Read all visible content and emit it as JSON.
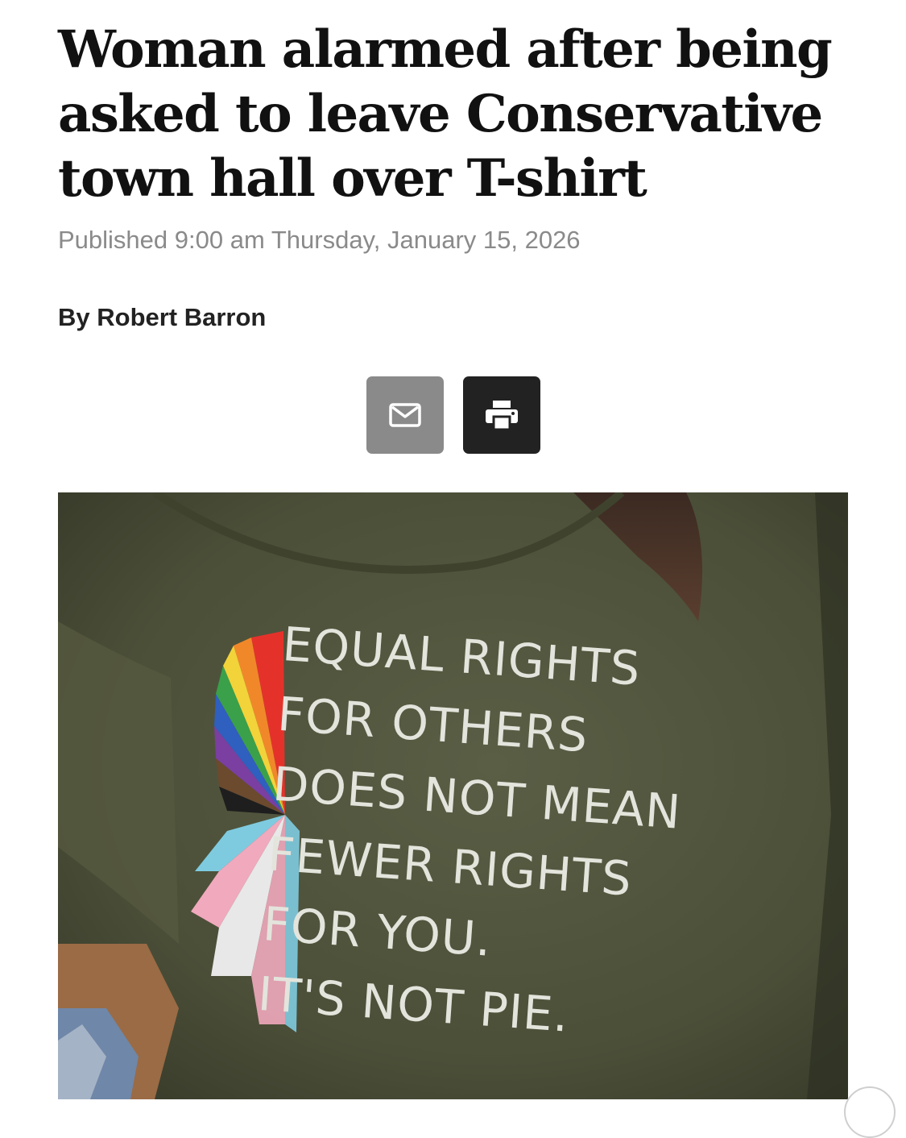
{
  "article": {
    "headline": "Woman alarmed after being asked to leave Conservative town hall over T-shirt",
    "published": "Published 9:00 am Thursday, January 15, 2026",
    "byline": "By Robert Barron"
  },
  "share": {
    "email_icon": "envelope-icon",
    "print_icon": "printer-icon"
  },
  "photo": {
    "shirt_lines": [
      "EQUAL RIGHTS",
      "FOR OTHERS",
      "DOES NOT MEAN",
      "FEWER RIGHTS",
      "FOR YOU.",
      "IT'S NOT PIE."
    ]
  },
  "colors": {
    "email_button": "#8a8a8a",
    "print_button": "#222222",
    "meta_text": "#8a8a8a",
    "shirt_green": "#4d513a"
  }
}
